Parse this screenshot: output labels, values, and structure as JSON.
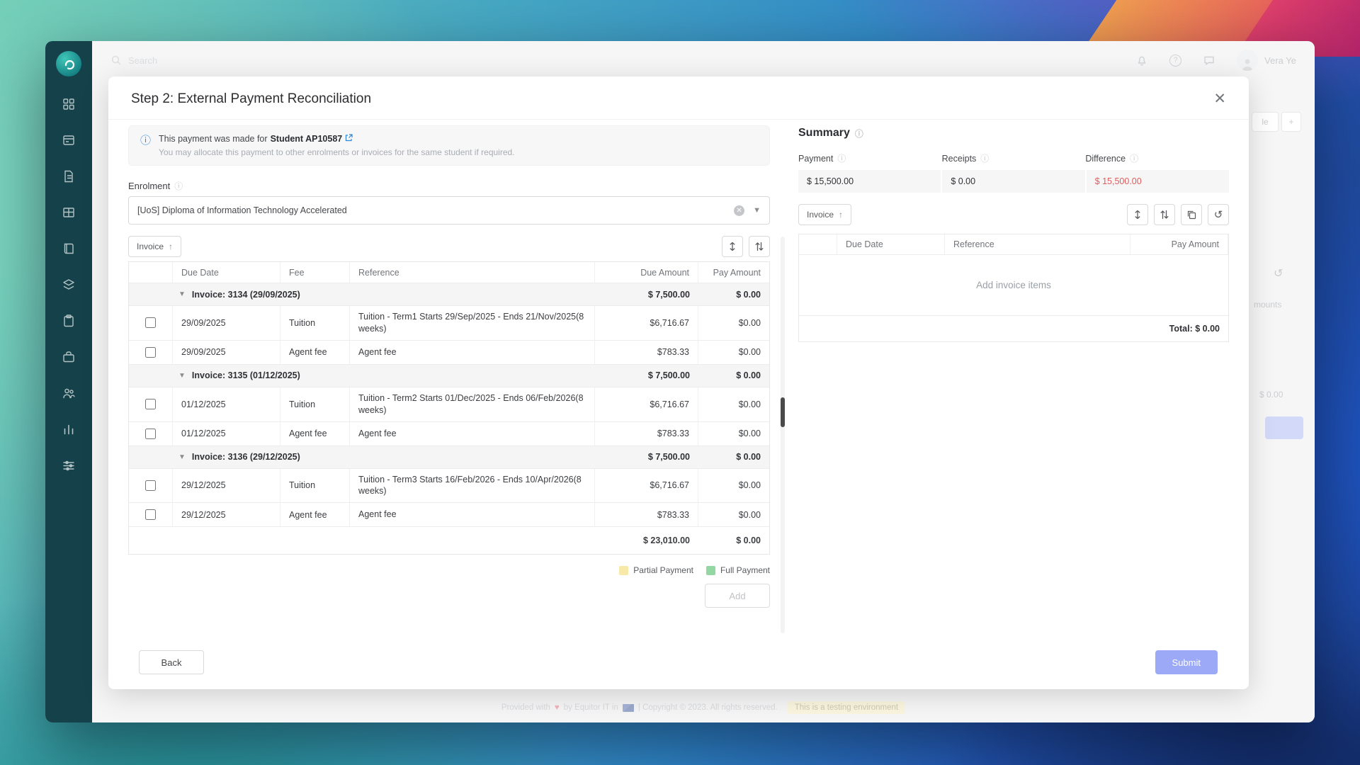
{
  "topbar": {
    "search_placeholder": "Search",
    "user_name": "Vera Ye"
  },
  "modal": {
    "title": "Step 2: External Payment Reconciliation",
    "info_banner": {
      "line1_prefix": "This payment was made for",
      "student_link": "Student AP10587",
      "line2": "You may allocate this payment to other enrolments or invoices for the same student if required."
    },
    "enrolment": {
      "label": "Enrolment",
      "selected": "[UoS] Diploma of Information Technology Accelerated"
    },
    "invoice_sort_label": "Invoice",
    "table": {
      "headers": {
        "due_date": "Due Date",
        "fee": "Fee",
        "reference": "Reference",
        "due_amount": "Due Amount",
        "pay_amount": "Pay Amount"
      },
      "groups": [
        {
          "title": "Invoice: 3134 (29/09/2025)",
          "due_amount": "$ 7,500.00",
          "pay_amount": "$ 0.00",
          "rows": [
            {
              "due_date": "29/09/2025",
              "fee": "Tuition",
              "reference": "Tuition - Term1 Starts 29/Sep/2025 - Ends 21/Nov/2025(8 weeks)",
              "due_amount": "$6,716.67",
              "pay_amount": "$0.00"
            },
            {
              "due_date": "29/09/2025",
              "fee": "Agent fee",
              "reference": "Agent fee",
              "due_amount": "$783.33",
              "pay_amount": "$0.00"
            }
          ]
        },
        {
          "title": "Invoice: 3135 (01/12/2025)",
          "due_amount": "$ 7,500.00",
          "pay_amount": "$ 0.00",
          "rows": [
            {
              "due_date": "01/12/2025",
              "fee": "Tuition",
              "reference": "Tuition - Term2 Starts 01/Dec/2025 - Ends 06/Feb/2026(8 weeks)",
              "due_amount": "$6,716.67",
              "pay_amount": "$0.00"
            },
            {
              "due_date": "01/12/2025",
              "fee": "Agent fee",
              "reference": "Agent fee",
              "due_amount": "$783.33",
              "pay_amount": "$0.00"
            }
          ]
        },
        {
          "title": "Invoice: 3136 (29/12/2025)",
          "due_amount": "$ 7,500.00",
          "pay_amount": "$ 0.00",
          "rows": [
            {
              "due_date": "29/12/2025",
              "fee": "Tuition",
              "reference": "Tuition - Term3 Starts 16/Feb/2026 - Ends 10/Apr/2026(8 weeks)",
              "due_amount": "$6,716.67",
              "pay_amount": "$0.00"
            },
            {
              "due_date": "29/12/2025",
              "fee": "Agent fee",
              "reference": "Agent fee",
              "due_amount": "$783.33",
              "pay_amount": "$0.00"
            }
          ]
        }
      ],
      "total_due": "$ 23,010.00",
      "total_pay": "$ 0.00"
    },
    "legend": {
      "partial": "Partial Payment",
      "partial_color": "#f7e9a8",
      "full": "Full Payment",
      "full_color": "#93d7a3"
    },
    "add_button": "Add",
    "back_button": "Back",
    "submit_button": "Submit",
    "summary": {
      "title": "Summary",
      "payment_label": "Payment",
      "payment_value": "$ 15,500.00",
      "receipts_label": "Receipts",
      "receipts_value": "$ 0.00",
      "difference_label": "Difference",
      "difference_value": "$ 15,500.00",
      "difference_color": "#e05c5c",
      "invoice_sort_label": "Invoice",
      "headers": {
        "due_date": "Due Date",
        "reference": "Reference",
        "pay_amount": "Pay Amount"
      },
      "empty_text": "Add invoice items",
      "total_text": "Total: $ 0.00"
    }
  },
  "footer": {
    "provided_with": "Provided with",
    "heart": "♥",
    "by_line": "by Equitor IT in",
    "copyright": "| Copyright © 2023. All rights reserved.",
    "badge": "This is a testing environment"
  },
  "remnants": {
    "le": "le",
    "plus": "+",
    "amounts": "mounts",
    "zero": "$ 0.00"
  }
}
